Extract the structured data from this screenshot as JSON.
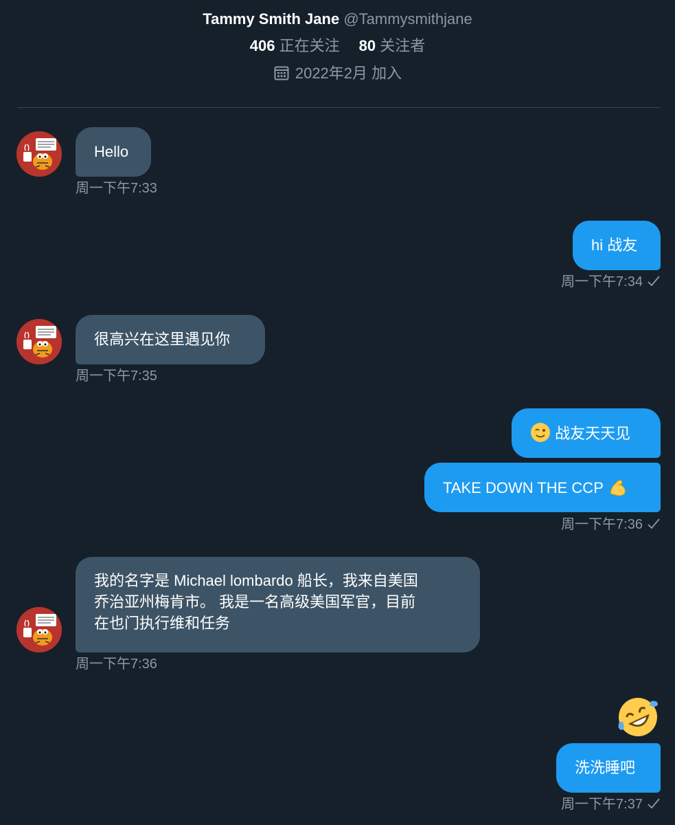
{
  "profile": {
    "display_name": "Tammy Smith Jane",
    "handle": "@Tammysmithjane",
    "following_count": "406",
    "following_label": "正在关注",
    "followers_count": "80",
    "followers_label": "关注者",
    "joined": "2022年2月 加入"
  },
  "messages": {
    "m1": {
      "text": "Hello",
      "time": "周一下午7:33"
    },
    "m2": {
      "text": "hi 战友",
      "time": "周一下午7:34"
    },
    "m3": {
      "text": "很高兴在这里遇见你",
      "time": "周一下午7:35"
    },
    "m4": {
      "text": "战友天天见",
      "emoji": "winking-face"
    },
    "m5": {
      "text": "TAKE DOWN THE CCP",
      "emoji": "flexed-biceps",
      "time": "周一下午7:36"
    },
    "m6": {
      "lines": [
        "我的名字是 Michael lombardo 船长，我来自美国",
        "乔治亚州梅肯市。 我是一名高级美国军官，目前",
        "在也门执行维和任务"
      ],
      "time": "周一下午7:36"
    },
    "m7": {
      "emoji": "rolling-on-the-floor-laughing"
    },
    "m8": {
      "text": "洗洗睡吧",
      "time": "周一下午7:37"
    }
  },
  "colors": {
    "background": "#15202b",
    "incoming_bubble": "#3d5466",
    "outgoing_bubble": "#1d9bf0",
    "muted_text": "#8b98a5",
    "avatar_bg": "#b8342c"
  },
  "icons": {
    "calendar": "calendar-icon",
    "read_receipt": "checkmark-icon",
    "avatar": "garfield-avatar"
  }
}
